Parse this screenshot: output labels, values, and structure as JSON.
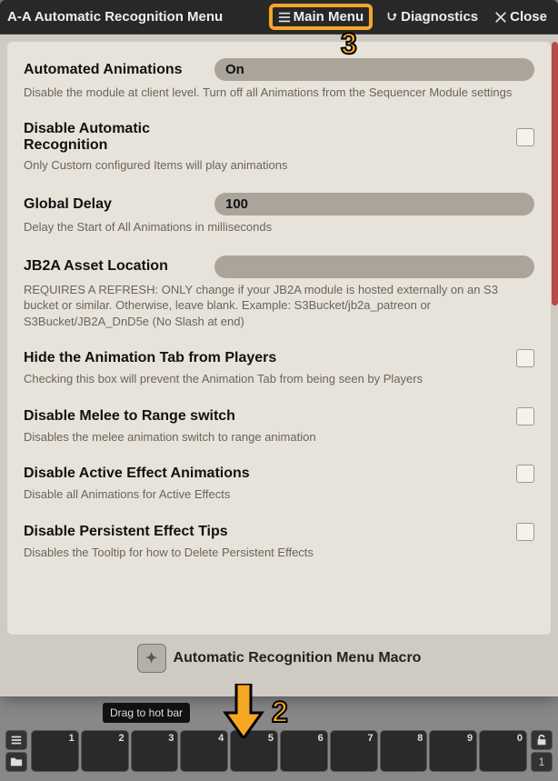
{
  "titlebar": {
    "title": "A-A Automatic Recognition Menu",
    "main_menu": "Main Menu",
    "diagnostics": "Diagnostics",
    "close": "Close"
  },
  "annot": {
    "three": "3",
    "two": "2"
  },
  "tooltip": "Drag to hot bar",
  "footer": {
    "label": "Automatic Recognition Menu Macro"
  },
  "settings": {
    "autoAnim": {
      "label": "Automated Animations",
      "value": "On",
      "desc": "Disable the module at client level. Turn off all Animations from the Sequencer Module settings"
    },
    "disableAuto": {
      "label": "Disable Automatic Recognition",
      "desc": "Only Custom configured Items will play animations"
    },
    "globalDelay": {
      "label": "Global Delay",
      "value": "100",
      "desc": "Delay the Start of All Animations in milliseconds"
    },
    "jb2a": {
      "label": "JB2A Asset Location",
      "value": "",
      "desc": "REQUIRES A REFRESH: ONLY change if your JB2A module is hosted externally on an S3 bucket or similar. Otherwise, leave blank. Example: S3Bucket/jb2a_patreon or S3Bucket/JB2A_DnD5e (No Slash at end)"
    },
    "hideTab": {
      "label": "Hide the Animation Tab from Players",
      "desc": "Checking this box will prevent the Animation Tab from being seen by Players"
    },
    "meleeRange": {
      "label": "Disable Melee to Range switch",
      "desc": "Disables the melee animation switch to range animation"
    },
    "activeEffect": {
      "label": "Disable Active Effect Animations",
      "desc": "Disable all Animations for Active Effects"
    },
    "persistTips": {
      "label": "Disable Persistent Effect Tips",
      "desc": "Disables the Tooltip for how to Delete Persistent Effects"
    }
  },
  "hotbar": {
    "slots": [
      "1",
      "2",
      "3",
      "4",
      "5",
      "6",
      "7",
      "8",
      "9",
      "0"
    ],
    "page": "1"
  }
}
